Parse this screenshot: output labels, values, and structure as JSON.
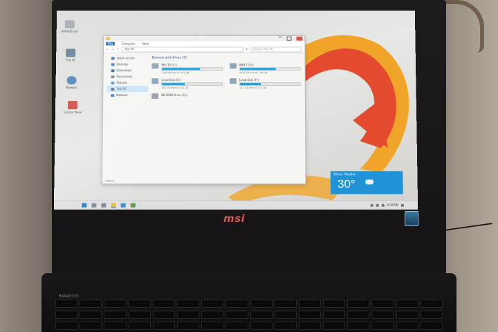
{
  "laptop": {
    "brand": "msi",
    "keyboard_label": "BANASSCO"
  },
  "desktop": {
    "icons": [
      {
        "label": "AliMatEhsan",
        "icon": "user-folder-icon",
        "color": "#9aa3ad"
      },
      {
        "label": "This PC",
        "icon": "computer-icon",
        "color": "#5e7a92"
      },
      {
        "label": "Network",
        "icon": "network-icon",
        "color": "#4a7fb5"
      },
      {
        "label": "Control Panel",
        "icon": "control-panel-icon",
        "color": "#c9483e"
      }
    ]
  },
  "explorer": {
    "title_tabs": [
      "File",
      "Computer",
      "View"
    ],
    "address": "This PC",
    "search_placeholder": "Search This PC",
    "nav": [
      {
        "label": "Quick access",
        "color": "#3b78c2",
        "selected": false
      },
      {
        "label": "Desktop",
        "color": "#3f7fc4",
        "selected": false
      },
      {
        "label": "Downloads",
        "color": "#3a6fa8",
        "selected": false
      },
      {
        "label": "Documents",
        "color": "#7d8c99",
        "selected": false
      },
      {
        "label": "Pictures",
        "color": "#4f9ad1",
        "selected": false
      },
      {
        "label": "This PC",
        "color": "#5e7a92",
        "selected": true
      },
      {
        "label": "Network",
        "color": "#4a7fb5",
        "selected": false
      }
    ],
    "section_title": "Devices and drives (5)",
    "drives": [
      {
        "name": "Win 10 (C:)",
        "free": "74.6 GB free of 201 GB",
        "used": 0.63
      },
      {
        "name": "WIN 7 (D:)",
        "free": "59.8 GB free of 150 GB",
        "used": 0.6
      },
      {
        "name": "Local Disk (E:)",
        "free": "150 GB free of 241 GB",
        "used": 0.38
      },
      {
        "name": "Local Disk (F:)",
        "free": "111 GB free of 171 GB",
        "used": 0.35
      },
      {
        "name": "BD-ROM Drive (G:)",
        "free": "",
        "used": 0
      }
    ],
    "status": "5 items"
  },
  "weather": {
    "city": "Tehran, Weather",
    "temp": "30°"
  },
  "taskbar": {
    "clock": "4:34 PM"
  },
  "colors": {
    "wallpaper_orange": "#f0a52a",
    "wallpaper_red": "#e34a2e",
    "accent_blue": "#1f93d6"
  }
}
